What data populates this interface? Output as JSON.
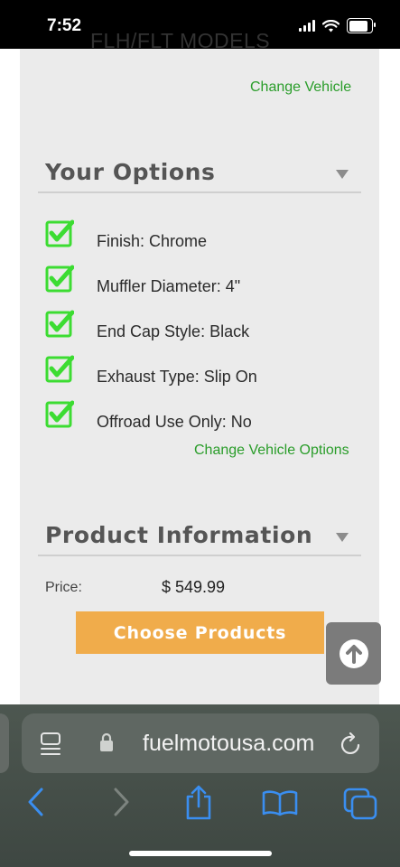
{
  "status_bar": {
    "time": "7:52"
  },
  "vehicle": {
    "model_title": "FLH/FLT MODELS",
    "change_vehicle_link": "Change Vehicle"
  },
  "options_section": {
    "title": "Your Options",
    "items": [
      {
        "label": "Finish: Chrome",
        "checked": true
      },
      {
        "label": "Muffler Diameter: 4\"",
        "checked": true
      },
      {
        "label": "End Cap Style: Black",
        "checked": true
      },
      {
        "label": "Exhaust Type: Slip On",
        "checked": true
      },
      {
        "label": "Offroad Use Only: No",
        "checked": true
      }
    ],
    "change_options_link": "Change Vehicle Options"
  },
  "product_section": {
    "title": "Product Information",
    "price_label": "Price:",
    "price_value": "$ 549.99",
    "choose_button": "Choose Products"
  },
  "browser": {
    "url": "fuelmotousa.com"
  },
  "colors": {
    "link_green": "#2a9d2a",
    "check_green": "#3cdc32",
    "button_orange": "#f0ac4b"
  },
  "icons": [
    "signal-icon",
    "wifi-icon",
    "battery-icon",
    "checkbox-checked-icon",
    "caret-down-icon",
    "scroll-top-icon",
    "tab-overview-icon",
    "lock-icon",
    "reload-icon",
    "back-icon",
    "forward-icon",
    "share-icon",
    "bookmarks-icon",
    "tabs-icon"
  ]
}
